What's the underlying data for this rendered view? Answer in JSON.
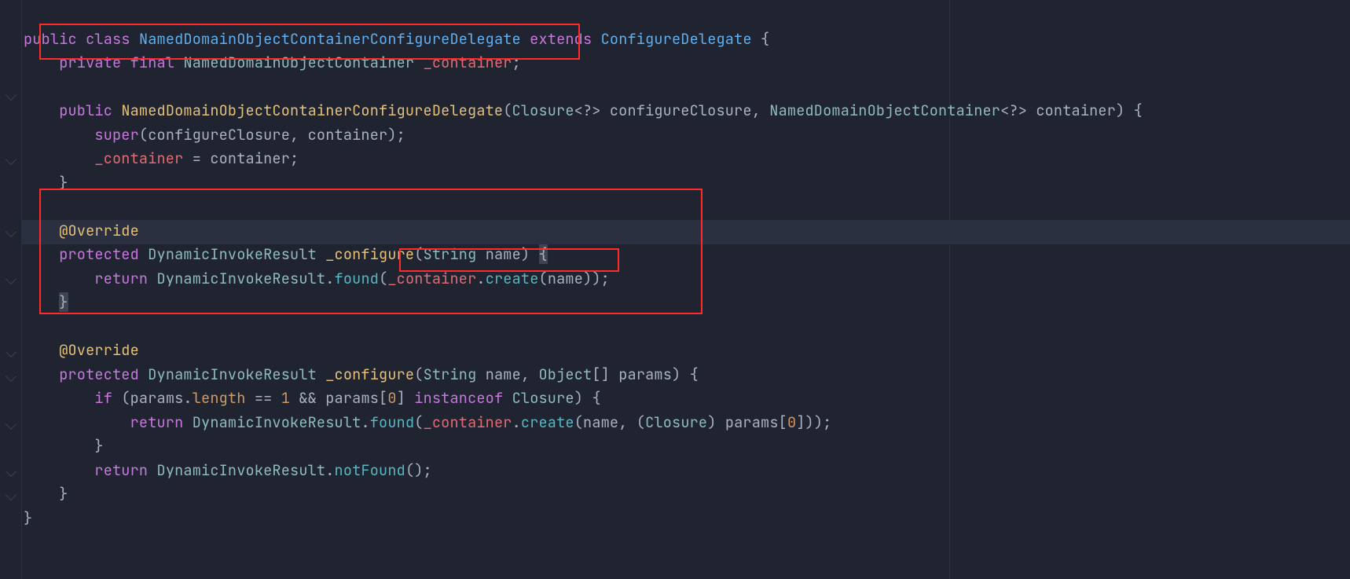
{
  "code": {
    "l1": {
      "kw1": "public",
      "kw2": "class",
      "name": "NamedDomainObjectContainerConfigureDelegate",
      "kw3": "extends",
      "sup": "ConfigureDelegate",
      "brace": "{"
    },
    "l2": {
      "kw1": "private",
      "kw2": "final",
      "type": "NamedDomainObjectContainer",
      "field": "_container",
      "semi": ";"
    },
    "l4": {
      "kw": "public",
      "name": "NamedDomainObjectContainerConfigureDelegate",
      "p1t": "Closure",
      "q": "<?>",
      "p1n": "configureClosure",
      "p2t": "NamedDomainObjectContainer",
      "p2n": "container",
      "b": ") {"
    },
    "l5": {
      "supr": "super",
      "a": "(configureClosure, container);"
    },
    "l6": {
      "f": "_container",
      "eq": " = container;"
    },
    "l7": {
      "b": "}"
    },
    "l9": {
      "ann": "@Override"
    },
    "l10": {
      "kw": "protected",
      "ret": "DynamicInvokeResult",
      "fn": "_configure",
      "sigL": "(",
      "pT": "String",
      "pN": "name",
      "sigR": ") ",
      "brace": "{"
    },
    "l11": {
      "kw": "return",
      "cls": "DynamicInvokeResult",
      "dot": ".",
      "fn": "found",
      "L": "(",
      "field": "_container",
      "dot2": ".",
      "fn2": "create",
      "arg": "(name)",
      "R": ");"
    },
    "l12": {
      "b": "}"
    },
    "l14": {
      "ann": "@Override"
    },
    "l15": {
      "kw": "protected",
      "ret": "DynamicInvokeResult",
      "fn": "_configure",
      "sig": "(",
      "p1t": "String",
      "p1n": "name",
      "c": ", ",
      "p2t": "Object",
      "arr": "[]",
      "p2n": "params",
      "r": ") {"
    },
    "l16": {
      "kw": "if",
      "L": " (params.",
      "len": "length",
      "eq": " == ",
      "one": "1",
      "and": " && params[",
      "zero": "0",
      "r": "] ",
      "inst": "instanceof",
      "cls": "Closure",
      "b": ") {"
    },
    "l17": {
      "kw": "return",
      "cls": "DynamicInvokeResult",
      "dot": ".",
      "fn": "found",
      "L": "(",
      "field": "_container",
      "dot2": ".",
      "fn2": "create",
      "a": "(name, (",
      "cast": "Closure",
      "b": ") params[",
      "zero": "0",
      "c": "]));"
    },
    "l18": {
      "b": "}"
    },
    "l19": {
      "kw": "return",
      "cls": "DynamicInvokeResult",
      "dot": ".",
      "fn": "notFound",
      "r": "();"
    },
    "l20": {
      "b": "}"
    },
    "l21": {
      "b": "}"
    }
  }
}
